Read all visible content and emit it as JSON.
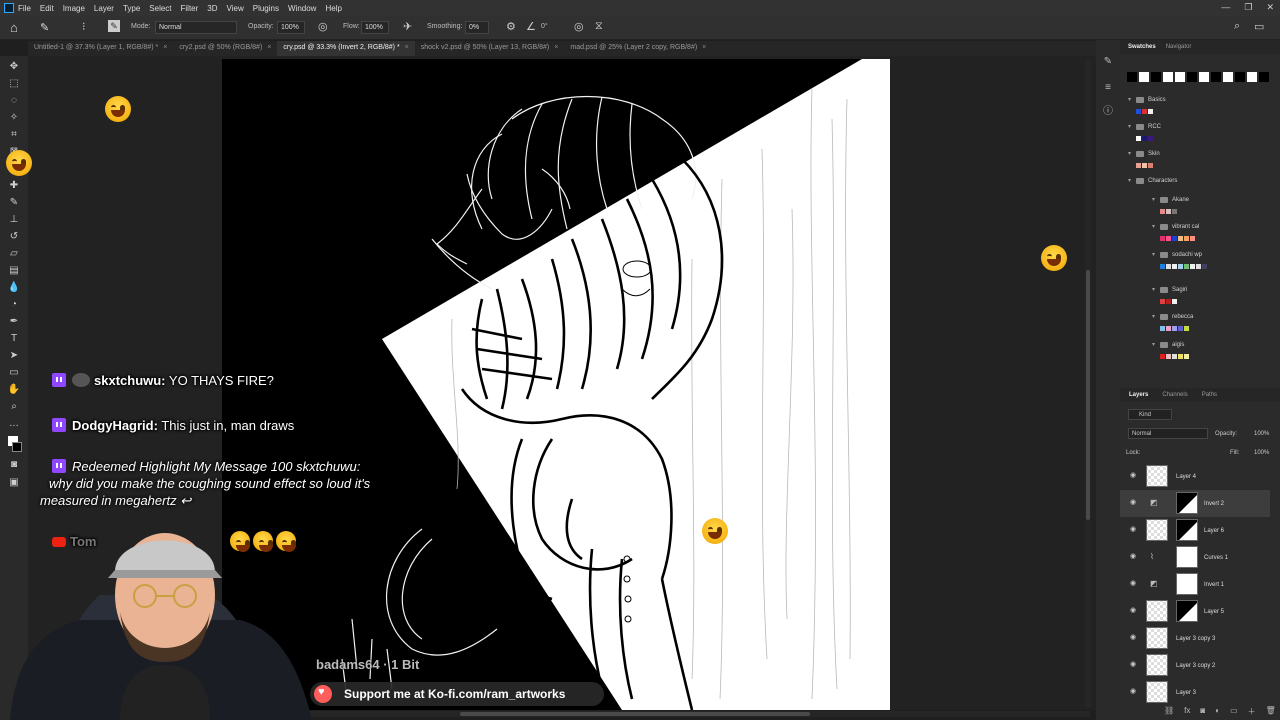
{
  "menu": [
    "File",
    "Edit",
    "Image",
    "Layer",
    "Type",
    "Select",
    "Filter",
    "3D",
    "View",
    "Plugins",
    "Window",
    "Help"
  ],
  "window_controls": [
    "—",
    "❐",
    "✕"
  ],
  "options": {
    "mode_label": "Mode:",
    "mode_value": "Normal",
    "opacity_label": "Opacity:",
    "opacity_value": "100%",
    "flow_label": "Flow:",
    "flow_value": "100%",
    "smoothing_label": "Smoothing:",
    "smoothing_value": "0%",
    "angle_value": "0°"
  },
  "tabs": [
    {
      "label": "Untitled-1 @ 37.3% (Layer 1, RGB/8#) *",
      "active": false
    },
    {
      "label": "cry2.psd @ 50% (RGB/8#)",
      "active": false
    },
    {
      "label": "cry.psd @ 33.3% (Invert 2, RGB/8#) *",
      "active": true
    },
    {
      "label": "shock v2.psd @ 50% (Layer 13, RGB/8#)",
      "active": false
    },
    {
      "label": "mad.psd @ 25% (Layer 2 copy, RGB/8#)",
      "active": false
    }
  ],
  "panels": {
    "top_tabs": [
      "Swatches",
      "Navigator"
    ],
    "swatch_groups": [
      {
        "name": "Basics",
        "colors": [
          "#1f4fd6",
          "#d63030",
          "#f0f0f0"
        ]
      },
      {
        "name": "RCC",
        "colors": [
          "#ffffff",
          "#1a1a6a",
          "#3a1a7a"
        ]
      },
      {
        "name": "Skin",
        "colors": [
          "#e8a090",
          "#f2c0a8",
          "#d98070"
        ]
      },
      {
        "name": "Characters",
        "colors": []
      },
      {
        "name": "Akane",
        "colors": [
          "#e88a8a",
          "#d6c0c0",
          "#777777"
        ]
      },
      {
        "name": "vibrant cal",
        "colors": [
          "#e03070",
          "#ff5090",
          "#2040d0",
          "#f0c080",
          "#f7a060",
          "#ff9080"
        ]
      },
      {
        "name": "sodachi wp",
        "colors": [
          "#2080e0",
          "#e0e0e0",
          "#f0f0f0",
          "#a0d0f0",
          "#70c070",
          "#f0f0f0",
          "#e0e0e0",
          "#404060"
        ]
      },
      {
        "name": "Sagiri",
        "colors": [
          "#e04040",
          "#b02020",
          "#f0f0f0"
        ]
      },
      {
        "name": "rebecca",
        "colors": [
          "#80c0f0",
          "#f0a0c0",
          "#a0a0f0",
          "#6060d0",
          "#c0e040"
        ]
      },
      {
        "name": "aigis",
        "colors": [
          "#e02020",
          "#f0c0c0",
          "#e0e0e0",
          "#f0e060",
          "#f0f0a0"
        ]
      }
    ],
    "layers_tabs": [
      "Layers",
      "Channels",
      "Paths"
    ],
    "layer_filter": "Kind",
    "blend_mode": "Normal",
    "opacity_label": "Opacity:",
    "opacity_value": "100%",
    "lock_label": "Lock:",
    "fill_label": "Fill:",
    "fill_value": "100%",
    "layers": [
      {
        "name": "Layer 4",
        "type": "pixel",
        "selected": false
      },
      {
        "name": "Invert 2",
        "type": "adjust-mask",
        "selected": true
      },
      {
        "name": "Layer 6",
        "type": "pixel-mask",
        "selected": false
      },
      {
        "name": "Curves 1",
        "type": "adjust",
        "selected": false
      },
      {
        "name": "Invert 1",
        "type": "adjust",
        "selected": false
      },
      {
        "name": "Layer 5",
        "type": "pixel-mask",
        "selected": false
      },
      {
        "name": "Layer 3 copy 3",
        "type": "pixel",
        "selected": false
      },
      {
        "name": "Layer 3 copy 2",
        "type": "pixel",
        "selected": false
      },
      {
        "name": "Layer 3",
        "type": "pixel",
        "selected": false
      }
    ]
  },
  "chat": [
    {
      "user": "skxtchuwu:",
      "message": "YO THAYS FIRE?"
    },
    {
      "user": "DodgyHagrid:",
      "message": "This just in, man draws"
    }
  ],
  "redeem": {
    "title": "Redeemed Highlight My Message",
    "amount": "100",
    "user": "skxtchuwu:",
    "text": "why did you make the coughing sound effect so loud it's measured in megahertz"
  },
  "youtube_user": "Tom",
  "bits_alert": "badams64 · 1 Bit",
  "kofi": "Support me at Ko-fi.com/ram_artworks",
  "colors": {
    "accent": "#31a8ff",
    "twitch": "#9146ff",
    "kofi": "#ff5e5b"
  }
}
